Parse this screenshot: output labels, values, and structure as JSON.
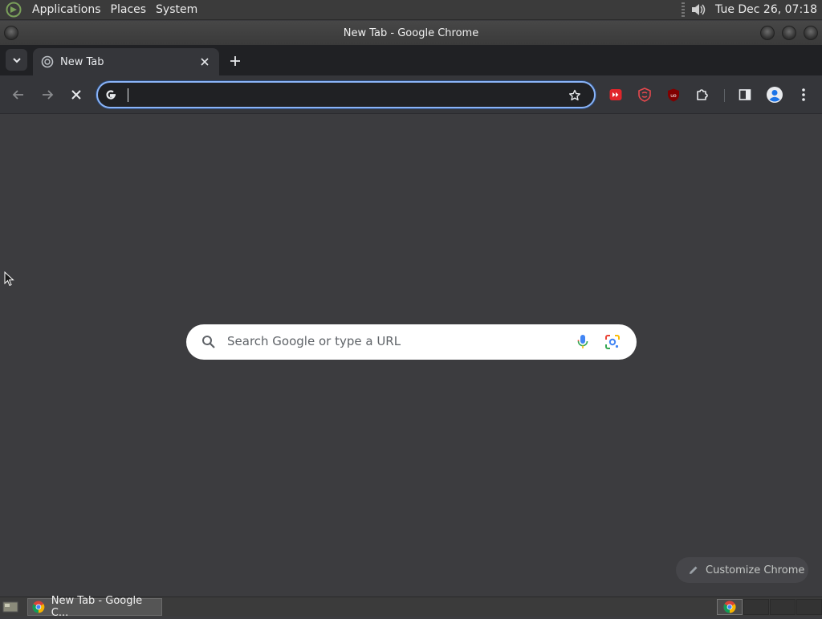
{
  "top_panel": {
    "menus": [
      "Applications",
      "Places",
      "System"
    ],
    "clock": "Tue Dec 26, 07:18"
  },
  "window": {
    "title": "New Tab - Google Chrome"
  },
  "tabs": [
    {
      "label": "New Tab",
      "active": true
    }
  ],
  "omnibox": {
    "value": "",
    "placeholder": ""
  },
  "toolbar": {
    "extensions": [
      "video-speed-controller-icon",
      "surfshark-icon",
      "ublock-origin-icon",
      "extensions-puzzle-icon"
    ]
  },
  "ntp": {
    "search_placeholder": "Search Google or type a URL",
    "customize_label": "Customize Chrome"
  },
  "taskbar": {
    "items": [
      {
        "label": "New Tab - Google C..."
      }
    ],
    "workspaces": 4,
    "active_workspace": 1
  },
  "colors": {
    "accent": "#8ab4f8",
    "page_bg": "#3c3c3f",
    "toolbar_bg": "#35363a",
    "tabstrip_bg": "#202124"
  }
}
